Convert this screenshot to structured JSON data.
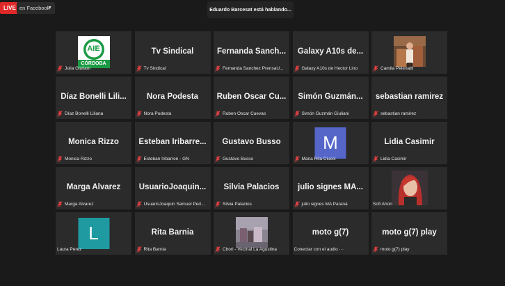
{
  "live": {
    "badge": "LIVE",
    "destination": "en Facebook"
  },
  "speaker": {
    "text": "Eduardo Barcesat está hablando..."
  },
  "colors": {
    "live_red": "#e02828",
    "muted_red": "#e04040",
    "avatar_m": "#5566c8",
    "avatar_l": "#1e9aa0"
  },
  "tiles": [
    {
      "name": "",
      "label": "Julia Giuliani",
      "visual": "aie-logo",
      "logo_text": "AIE",
      "logo_sub": "CÓRDOBA"
    },
    {
      "name": "Tv Sindical",
      "label": "Tv Sindical"
    },
    {
      "name": "Fernanda Sanch...",
      "label": "Fernanda Sanchez PrensaU..."
    },
    {
      "name": "Galaxy A10s de...",
      "label": "Galaxy A10s de Hector Lino"
    },
    {
      "name": "",
      "label": "Camila Pelenatti",
      "visual": "photo-camila"
    },
    {
      "name": "Díaz Bonelli Lili...",
      "label": "Díaz Bonelli Liliana"
    },
    {
      "name": "Nora Podesta",
      "label": "Nora Podesta"
    },
    {
      "name": "Ruben Oscar Cu...",
      "label": "Ruben Oscar Cuevas"
    },
    {
      "name": "Simón Guzmán...",
      "label": "Simón Guzmán Giuliani"
    },
    {
      "name": "sebastian ramirez",
      "label": "sebastian ramirez"
    },
    {
      "name": "Monica Rizzo",
      "label": "Monica Rizzo"
    },
    {
      "name": "Esteban Iribarre...",
      "label": "Esteban Iribarren - GN"
    },
    {
      "name": "Gustavo Busso",
      "label": "Gustavo Busso"
    },
    {
      "name": "",
      "label": "Maria Rita Ciucci",
      "visual": "letter",
      "letter": "M"
    },
    {
      "name": "Lidia Casimir",
      "label": "Lidia Casimir"
    },
    {
      "name": "Marga Alvarez",
      "label": "Marga Alvarez"
    },
    {
      "name": "UsuarioJoaquin...",
      "label": "UsuarioJoaquin Samuel Ped..."
    },
    {
      "name": "Silvia Palacios",
      "label": "Silvia Palacios"
    },
    {
      "name": "julio signes MA...",
      "label": "julio signes MA Paraná"
    },
    {
      "name": "",
      "label": "Sofi Ahún",
      "visual": "photo-sofi",
      "no_mic": true
    },
    {
      "name": "",
      "label": "Laura Perez",
      "visual": "letter",
      "letter": "L",
      "no_mic": true
    },
    {
      "name": "Rita Barnia",
      "label": "Rita Barnia"
    },
    {
      "name": "",
      "label": "Chori - Vecinal La Agustina",
      "visual": "photo-chori"
    },
    {
      "name": "moto g(7)",
      "label": "Conectar con el audio ···",
      "no_mic": true
    },
    {
      "name": "moto g(7) play",
      "label": "moto g(7) play"
    }
  ]
}
